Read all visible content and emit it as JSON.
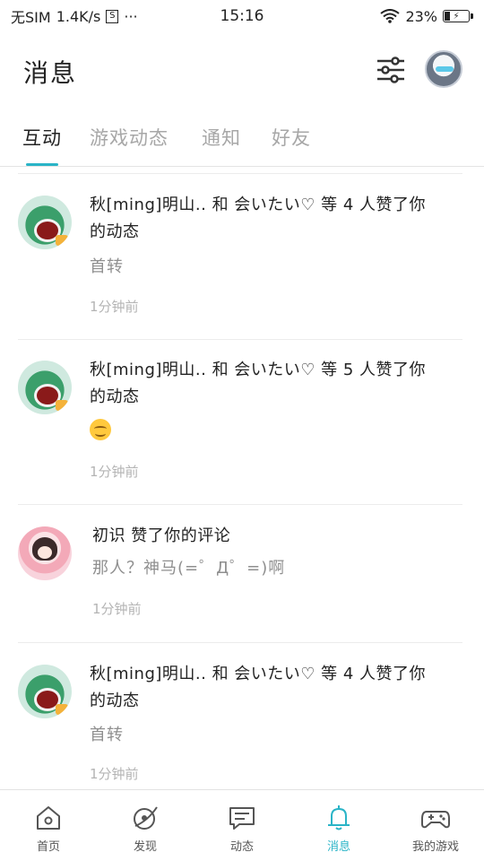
{
  "status_bar": {
    "carrier": "无SIM",
    "speed": "1.4K/s",
    "sim_icon_text": "S",
    "more": "···",
    "time": "15:16",
    "battery": "23%"
  },
  "header": {
    "title": "消息"
  },
  "tabs": [
    {
      "label": "互动",
      "active": true
    },
    {
      "label": "游戏动态",
      "active": false
    },
    {
      "label": "通知",
      "active": false
    },
    {
      "label": "好友",
      "active": false
    }
  ],
  "feed": [
    {
      "text_line1": "秋[ming]明山.. 和 会いたい♡ 等 4 人赞了你",
      "text_line2": "的动态",
      "quote": "首转",
      "time": "1分钟前",
      "avatar": "frog-avatar"
    },
    {
      "text_line1": "秋[ming]明山.. 和 会いたい♡ 等 5 人赞了你",
      "text_line2": "的动态",
      "quote": "",
      "emoji": "smile-emoji",
      "time": "1分钟前",
      "avatar": "frog-avatar"
    },
    {
      "text_line1": "初识 赞了你的评论",
      "text_line2": "",
      "quote": "那人？神马(=゜Д゜=)啊",
      "time": "1分钟前",
      "avatar": "girl-avatar"
    },
    {
      "text_line1": "秋[ming]明山.. 和 会いたい♡ 等 4 人赞了你",
      "text_line2": "的动态",
      "quote": "首转",
      "time": "1分钟前",
      "avatar": "frog-avatar"
    }
  ],
  "bottom_nav": [
    {
      "label": "首页",
      "icon": "home-icon",
      "active": false
    },
    {
      "label": "发现",
      "icon": "discover-icon",
      "active": false
    },
    {
      "label": "动态",
      "icon": "feed-icon",
      "active": false
    },
    {
      "label": "消息",
      "icon": "bell-icon",
      "active": true
    },
    {
      "label": "我的游戏",
      "icon": "gamepad-icon",
      "active": false
    }
  ],
  "colors": {
    "accent": "#2ab4c7",
    "text": "#222222",
    "muted": "#a7a7a7"
  }
}
